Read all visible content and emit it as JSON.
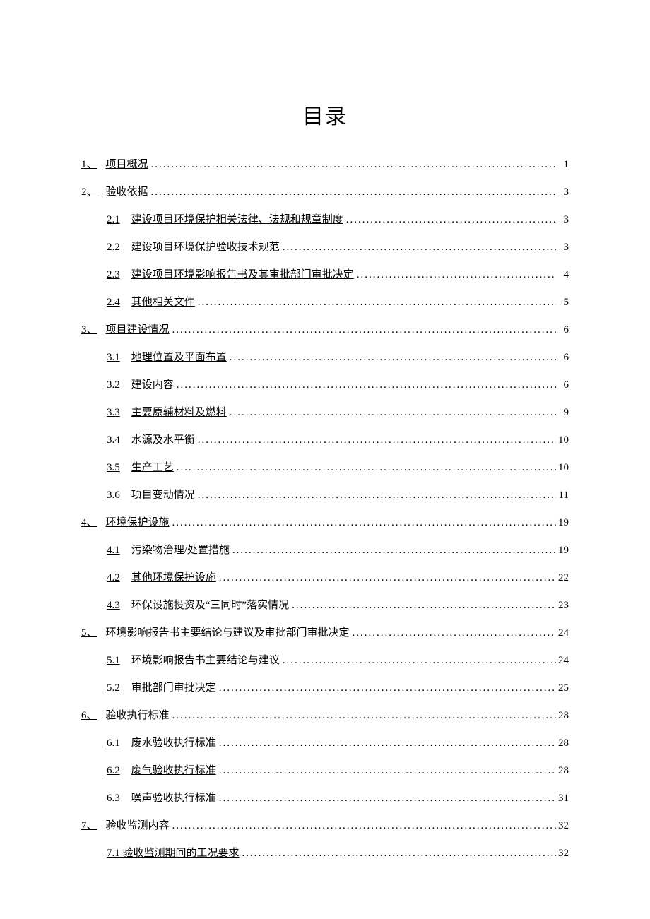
{
  "title": "目录",
  "entries": [
    {
      "level": 1,
      "num": "1、",
      "text": "项目概况",
      "page": "1",
      "numUnderline": true,
      "textUnderline": true
    },
    {
      "level": 1,
      "num": "2、",
      "text": "验收依据",
      "page": "3",
      "numUnderline": true,
      "textUnderline": true
    },
    {
      "level": 2,
      "num": "2.1",
      "text": "建设项目环境保护相关法律、法规和规章制度",
      "page": "3",
      "numUnderline": true,
      "textUnderline": true
    },
    {
      "level": 2,
      "num": "2.2",
      "text": "建设项目环境保护验收技术规范",
      "page": "3",
      "numUnderline": true,
      "textUnderline": true
    },
    {
      "level": 2,
      "num": "2.3",
      "text": "建设项目环境影响报告书及其审批部门审批决定",
      "page": "4",
      "numUnderline": true,
      "textUnderline": true
    },
    {
      "level": 2,
      "num": "2.4",
      "text": "其他相关文件",
      "page": "5",
      "numUnderline": true,
      "textUnderline": true
    },
    {
      "level": 1,
      "num": "3、",
      "text": "项目建设情况",
      "page": "6",
      "numUnderline": true,
      "textUnderline": true
    },
    {
      "level": 2,
      "num": "3.1",
      "text": "地理位置及平面布置",
      "page": "6",
      "numUnderline": true,
      "textUnderline": true
    },
    {
      "level": 2,
      "num": "3.2",
      "text": "建设内容",
      "page": "6",
      "numUnderline": true,
      "textUnderline": true
    },
    {
      "level": 2,
      "num": "3.3",
      "text": "主要原辅材料及燃料",
      "page": "9",
      "numUnderline": true,
      "textUnderline": true
    },
    {
      "level": 2,
      "num": "3.4",
      "text": "水源及水平衡",
      "page": "10",
      "numUnderline": true,
      "textUnderline": true
    },
    {
      "level": 2,
      "num": "3.5",
      "text": "生产工艺",
      "page": "10",
      "numUnderline": true,
      "textUnderline": true
    },
    {
      "level": 2,
      "num": "3.6",
      "text": "项目变动情况",
      "page": "11",
      "numUnderline": true,
      "textUnderline": false
    },
    {
      "level": 1,
      "num": "4、",
      "text": "环境保护设施",
      "page": "19",
      "numUnderline": true,
      "textUnderline": true
    },
    {
      "level": 2,
      "num": "4.1",
      "text": "污染物治理/处置措施",
      "page": "19",
      "numUnderline": true,
      "textUnderline": false
    },
    {
      "level": 2,
      "num": "4.2",
      "text": "其他环境保护设施",
      "page": "22",
      "numUnderline": true,
      "textUnderline": true
    },
    {
      "level": 2,
      "num": "4.3",
      "text": "环保设施投资及“三同时”落实情况",
      "page": "23",
      "numUnderline": true,
      "textUnderline": false
    },
    {
      "level": 1,
      "num": "5、",
      "text": "环境影响报告书主要结论与建议及审批部门审批决定",
      "page": "24",
      "numUnderline": true,
      "textUnderline": false
    },
    {
      "level": 2,
      "num": "5.1",
      "text": "环境影响报告书主要结论与建议",
      "page": "24",
      "numUnderline": true,
      "textUnderline": false
    },
    {
      "level": 2,
      "num": "5.2",
      "text": "审批部门审批决定",
      "page": "25",
      "numUnderline": true,
      "textUnderline": false
    },
    {
      "level": 1,
      "num": "6、",
      "text": "验收执行标准",
      "page": "28",
      "numUnderline": true,
      "textUnderline": false
    },
    {
      "level": 2,
      "num": "6.1",
      "text": "废水验收执行标准",
      "page": "28",
      "numUnderline": true,
      "textUnderline": false
    },
    {
      "level": 2,
      "num": "6.2",
      "text": "废气验收执行标准",
      "page": "28",
      "numUnderline": true,
      "textUnderline": true
    },
    {
      "level": 2,
      "num": "6.3",
      "text": "噪声验收执行标准",
      "page": "31",
      "numUnderline": true,
      "textUnderline": true
    },
    {
      "level": 1,
      "num": "7、",
      "text": "验收监测内容",
      "page": "32",
      "numUnderline": true,
      "textUnderline": false
    },
    {
      "level": 2,
      "num": "",
      "text": "7.1 验收监测期间的工况要求",
      "page": "32",
      "numUnderline": false,
      "textUnderline": true,
      "combined": true
    }
  ]
}
